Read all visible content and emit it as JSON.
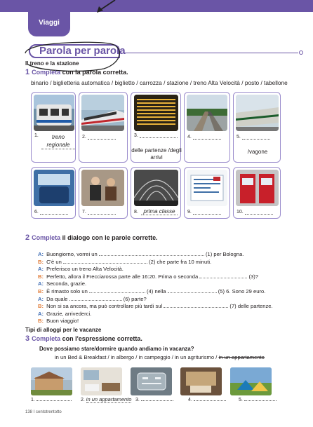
{
  "unit_tab": "Viaggi",
  "section_title": "Parola per parola",
  "subsection1": "Il treno e la stazione",
  "ex1": {
    "number": "1",
    "lead": "Completa",
    "rest": "con la parola corretta.",
    "word_bank": "binario / biglietteria automatica / biglietto / carrozza / stazione / treno Alta Velocità / posto / tabellone",
    "items": [
      {
        "n": "1.",
        "answer": "treno regionale",
        "caption": ""
      },
      {
        "n": "2.",
        "answer": "",
        "caption": ""
      },
      {
        "n": "3.",
        "answer": "",
        "caption": "delle partenze /degli arrivi"
      },
      {
        "n": "4.",
        "answer": "",
        "caption": ""
      },
      {
        "n": "5.",
        "answer": "",
        "caption": "/vagone"
      },
      {
        "n": "6.",
        "answer": "",
        "caption": ""
      },
      {
        "n": "7.",
        "answer": "",
        "caption": ""
      },
      {
        "n": "8.",
        "answer": "prima classe",
        "caption": ""
      },
      {
        "n": "9.",
        "answer": "",
        "caption": ""
      },
      {
        "n": "10.",
        "answer": "",
        "caption": ""
      }
    ]
  },
  "ex2": {
    "number": "2",
    "lead": "Completa",
    "rest": "il dialogo con le parole corrette.",
    "lines": [
      {
        "sp": "A:",
        "a": "Buongiorno, vorrei un",
        "b": "(1) per Bologna."
      },
      {
        "sp": "B:",
        "a": "C'è un",
        "b": "(2) che parte fra 10 minuti."
      },
      {
        "sp": "A:",
        "a": "Preferisco un treno Alta Velocità.",
        "b": ""
      },
      {
        "sp": "B:",
        "a": "Perfetto, allora il Frecciarossa parte alle 16:20. Prima o seconda",
        "b": "(3)?"
      },
      {
        "sp": "A:",
        "a": "Seconda, grazie.",
        "b": ""
      },
      {
        "sp": "B:",
        "a": "È rimasto solo un",
        "b": "(4) nella",
        "c": "(5) 6. Sono 29 euro."
      },
      {
        "sp": "A:",
        "a": "Da quale",
        "b": "(6) parte?"
      },
      {
        "sp": "B:",
        "a": "Non si sa ancora, ma può controllare più tardi sul",
        "b": "(7) delle partenze."
      },
      {
        "sp": "A:",
        "a": "Grazie, arrivederci.",
        "b": ""
      },
      {
        "sp": "B:",
        "a": "Buon viaggio!",
        "b": ""
      }
    ]
  },
  "subsection2": "Tipi di alloggi per le vacanze",
  "ex3": {
    "number": "3",
    "lead": "Completa",
    "rest": "con l'espressione corretta.",
    "question": "Dove possiamo stare/dormire quando andiamo in vacanza?",
    "bank_plain": "in un Bed & Breakfast / in albergo / in campeggio / in un agriturismo /",
    "bank_struck": "in un appartamento",
    "items": [
      {
        "n": "1.",
        "answer": ""
      },
      {
        "n": "2.",
        "answer": "in un appartamento"
      },
      {
        "n": "3.",
        "answer": ""
      },
      {
        "n": "4.",
        "answer": ""
      },
      {
        "n": "5.",
        "answer": ""
      }
    ]
  },
  "footer": {
    "page": "138",
    "sep": "I",
    "word": "centotrentotto"
  },
  "colors": {
    "accent": "#6a55a6",
    "speaker_a": "#3c6bb3",
    "speaker_b": "#e07a36"
  }
}
